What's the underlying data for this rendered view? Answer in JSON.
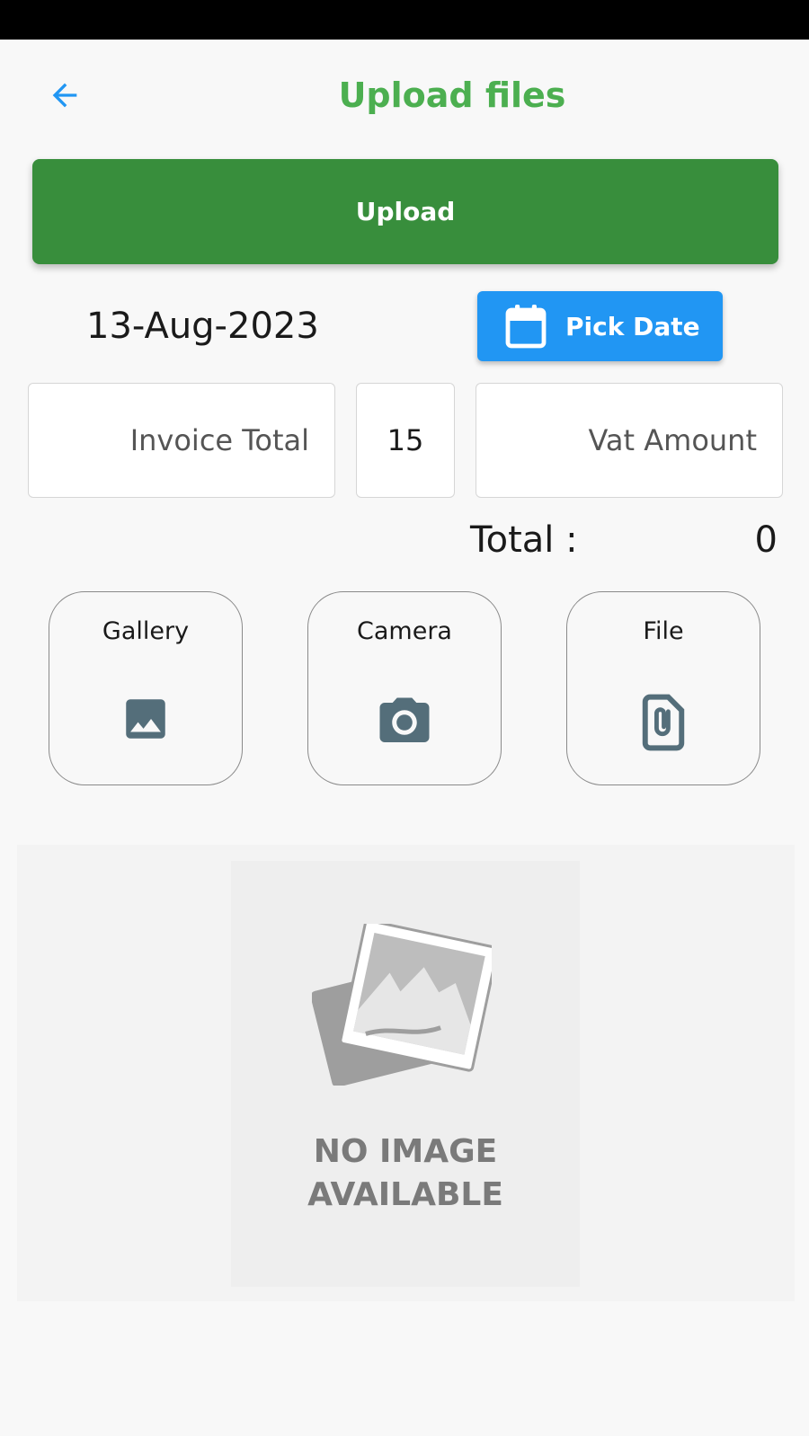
{
  "header": {
    "title": "Upload files",
    "back_icon": "arrow-left-icon",
    "title_color": "#4caf50"
  },
  "actions": {
    "upload_label": "Upload",
    "upload_color": "#388e3c"
  },
  "date": {
    "value": "13-Aug-2023",
    "pick_label": "Pick Date",
    "pick_icon": "calendar-icon",
    "pick_color": "#2196f3"
  },
  "fields": {
    "invoice_total_placeholder": "Invoice Total",
    "vat_rate_value": "15",
    "vat_amount_placeholder": "Vat Amount"
  },
  "total": {
    "label": "Total :",
    "value": "0"
  },
  "sources": [
    {
      "label": "Gallery",
      "icon": "image-icon"
    },
    {
      "label": "Camera",
      "icon": "camera-icon"
    },
    {
      "label": "File",
      "icon": "attachment-icon"
    }
  ],
  "icon_color": "#546e7a",
  "preview": {
    "line1": "NO IMAGE",
    "line2": "AVAILABLE"
  }
}
